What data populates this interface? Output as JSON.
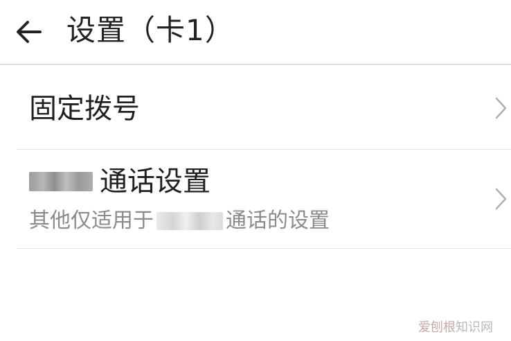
{
  "header": {
    "title": "设置（卡1）",
    "back_icon": "arrow-left-icon"
  },
  "rows": [
    {
      "title": "固定拨号",
      "icon": "chevron-right-icon"
    },
    {
      "title_suffix": "通话设置",
      "subtitle_prefix": "其他仅适用于",
      "subtitle_suffix": "通话的设置",
      "icon": "chevron-right-icon"
    }
  ],
  "watermark": {
    "part1": "爱刨根",
    "part2": "知识网"
  },
  "colors": {
    "title": "#1f1f1f",
    "subtitle": "#8a8a8a",
    "divider": "#e3e3e3",
    "chevron": "#b0b0b0"
  }
}
